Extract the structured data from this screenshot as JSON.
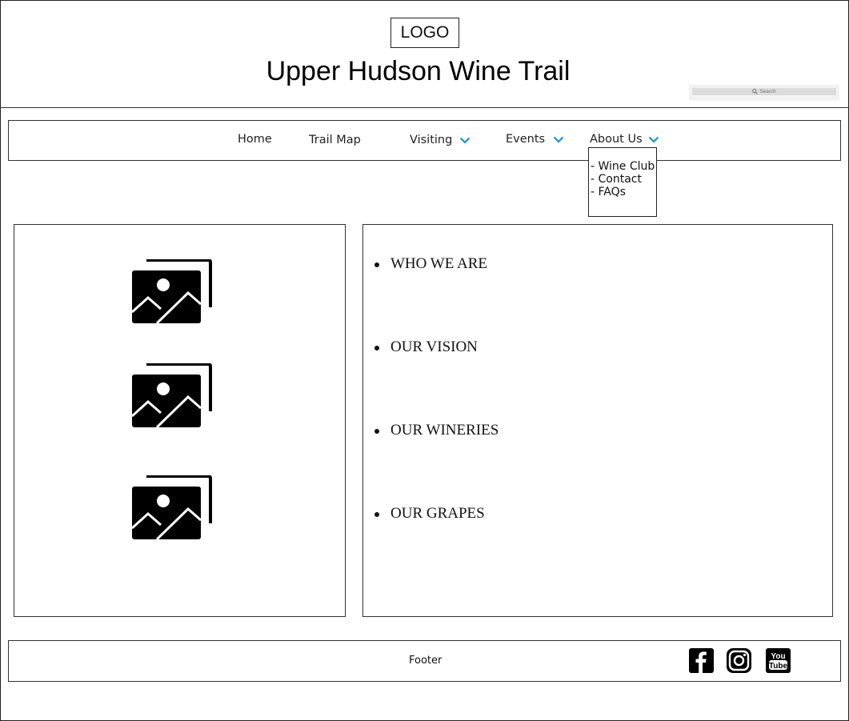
{
  "header": {
    "logo_text": "LOGO",
    "site_title": "Upper Hudson Wine Trail",
    "search_placeholder": "Search"
  },
  "nav": {
    "items": [
      {
        "label": "Home",
        "has_dropdown": false
      },
      {
        "label": "Trail Map",
        "has_dropdown": false
      },
      {
        "label": "Visiting",
        "has_dropdown": true
      },
      {
        "label": "Events",
        "has_dropdown": true
      },
      {
        "label": "About Us",
        "has_dropdown": true
      }
    ],
    "dropdown_open": "About Us",
    "dropdown_items": [
      "- Wine Club",
      "- Contact",
      "- FAQs"
    ],
    "chevron_color": "#1a8fe3"
  },
  "main": {
    "left_images": [
      "image-placeholder-icon",
      "image-placeholder-icon",
      "image-placeholder-icon"
    ],
    "sections": [
      "WHO WE ARE",
      "OUR VISION",
      "OUR WINERIES",
      "OUR GRAPES"
    ]
  },
  "footer": {
    "text": "Footer",
    "social": [
      "facebook-icon",
      "instagram-icon",
      "youtube-icon"
    ]
  }
}
